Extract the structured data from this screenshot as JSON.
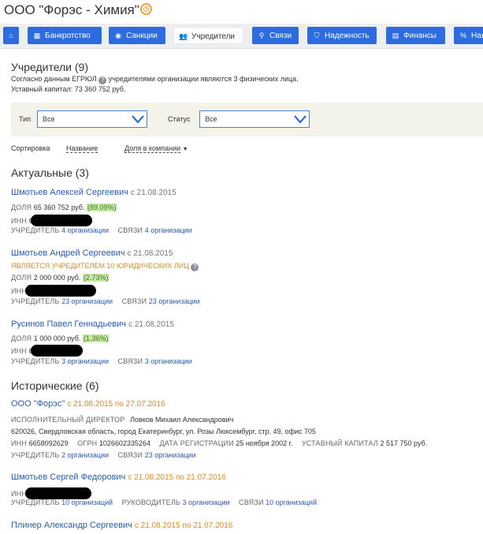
{
  "header": {
    "company_name": "ООО \"Форэс - Химия\"",
    "status_icon": "clock-icon"
  },
  "tabs": [
    {
      "label": "",
      "icon": "home-icon"
    },
    {
      "label": "Банкротство",
      "icon": "building-icon"
    },
    {
      "label": "Санкции",
      "icon": "globe-icon"
    },
    {
      "label": "Учредители",
      "icon": "people-icon"
    },
    {
      "label": "Связи",
      "icon": "network-icon"
    },
    {
      "label": "Надежность",
      "icon": "shield-icon"
    },
    {
      "label": "Финансы",
      "icon": "chart-icon"
    },
    {
      "label": "Нал",
      "icon": "percent-icon"
    }
  ],
  "founders_section": {
    "title": "Учредители (9)",
    "desc_before": "Согласно данным ЕГРЮЛ",
    "desc_after": "учредителями организации являются 3 физических лица.",
    "capital": "Уставный капитал: 73 360 752 руб."
  },
  "filters": {
    "type_label": "Тип",
    "type_value": "Все",
    "status_label": "Статус",
    "status_value": "Все"
  },
  "sort": {
    "label": "Сортировка",
    "by_name": "Название",
    "by_share": "Доля в компании",
    "arrow": "▼"
  },
  "actual": {
    "title": "Актуальные (3)",
    "items": [
      {
        "name": "Шмотьев Алексей Сергеевич",
        "since": "с 21.08.2015",
        "share_label": "ДОЛЯ",
        "share_value": "65 360 752 руб.",
        "share_pct": "(89.09%)",
        "inn_label": "ИНН",
        "inn_visible": "6",
        "founder_label": "УЧРЕДИТЕЛЬ",
        "founder_link": "4 организации",
        "links_label": "СВЯЗИ",
        "links_link": "4 организации"
      },
      {
        "name": "Шмотьев Андрей Сергеевич",
        "since": "с 21.08.2015",
        "note": "ЯВЛЯЕТСЯ УЧРЕДИТЕЛЕМ 10 ЮРИДИЧЕСКИХ ЛИЦ",
        "share_label": "ДОЛЯ",
        "share_value": "2 000 000 руб.",
        "share_pct": "(2.73%)",
        "inn_label": "ИНН",
        "founder_label": "УЧРЕДИТЕЛЬ",
        "founder_link": "23 организации",
        "links_label": "СВЯЗИ",
        "links_link": "23 организации"
      },
      {
        "name": "Русинов Павел Геннадьевич",
        "since": "с 21.08.2015",
        "share_label": "ДОЛЯ",
        "share_value": "1 000 000 руб.",
        "share_pct": "(1.36%)",
        "inn_label": "ИНН",
        "inn_visible": "6",
        "founder_label": "УЧРЕДИТЕЛЬ",
        "founder_link": "3 организации",
        "links_label": "СВЯЗИ",
        "links_link": "3 организации"
      }
    ]
  },
  "historical": {
    "title": "Исторические (6)",
    "org": {
      "name": "ООО \"Форэс\"",
      "period": "с 21.08.2015 по 27.07.2016",
      "director_label": "ИСПОЛНИТЕЛЬНЫЙ ДИРЕКТОР",
      "director_name": "Ловков Михаил Александрович",
      "address": "620026, Свердловская область, город Екатеринбург, ул. Розы Люксембург, стр. 49, офис 705",
      "inn_label": "ИНН",
      "inn_value": "6658092629",
      "ogrn_label": "ОГРН",
      "ogrn_value": "1026602335264",
      "reg_label": "ДАТА РЕГИСТРАЦИИ",
      "reg_value": "25 ноября 2002 г.",
      "capital_label": "УСТАВНЫЙ КАПИТАЛ",
      "capital_value": "2 517 750 руб.",
      "founder_label": "УЧРЕДИТЕЛЬ",
      "founder_link": "2 организации",
      "links_label": "СВЯЗИ",
      "links_link": "23 организации"
    },
    "person1": {
      "name": "Шмотьев Сергей Федорович",
      "period": "с 21.08.2015 по 21.07.2016",
      "inn_label": "ИНН",
      "founder_label": "УЧРЕДИТЕЛЬ",
      "founder_link": "10 организаций",
      "head_label": "РУКОВОДИТЕЛЬ",
      "head_link": "3 организации",
      "links_label": "СВЯЗИ",
      "links_link": "10 организаций"
    },
    "person2": {
      "name": "Плинер Александр Сергеевич",
      "period": "с 21.08.2015 по 21.07.2016"
    }
  }
}
